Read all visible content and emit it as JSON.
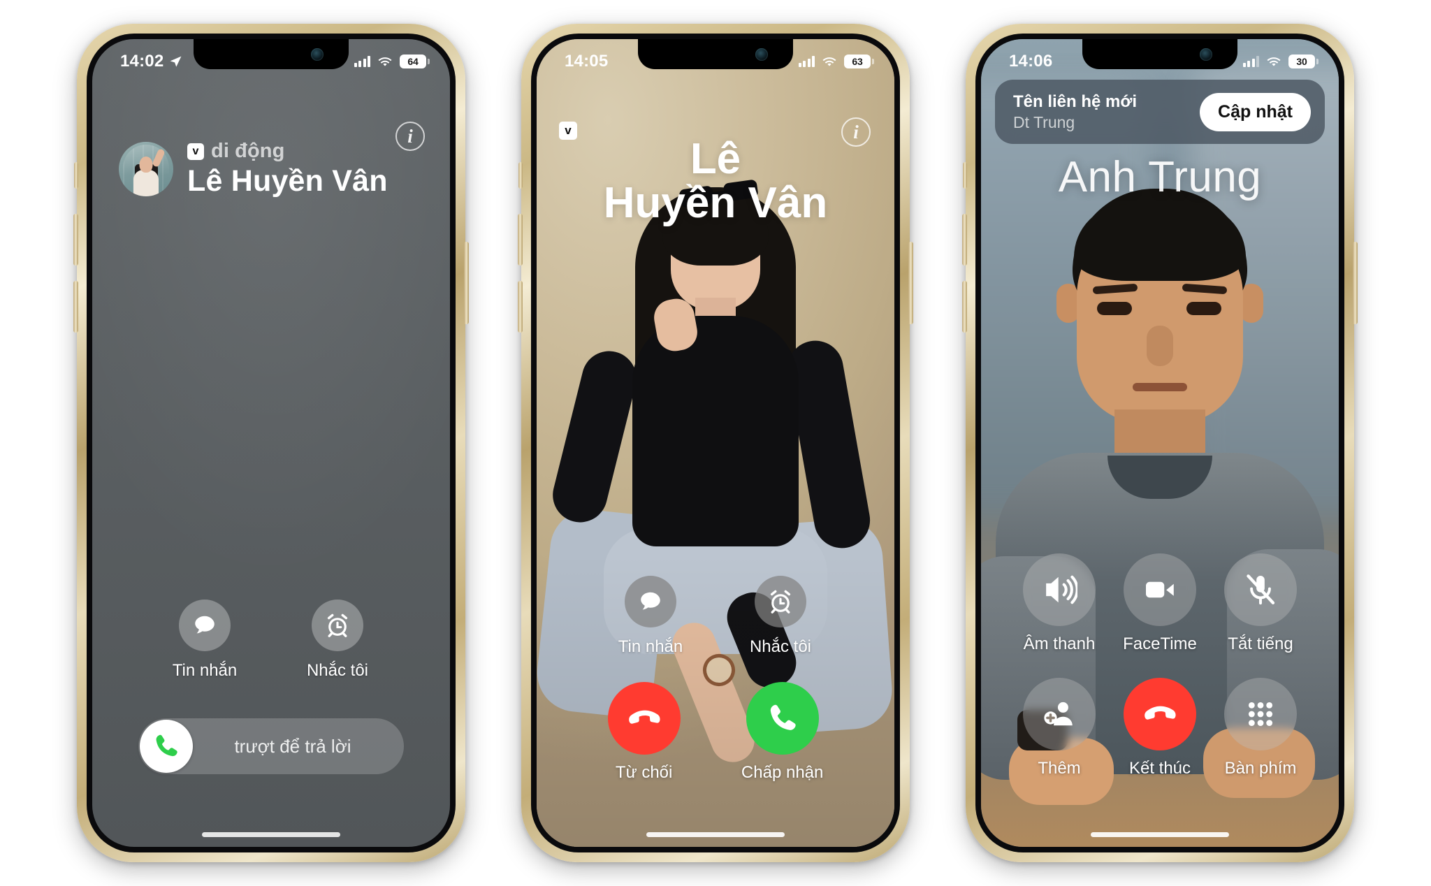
{
  "phones": [
    {
      "id": "phone-locked-incoming",
      "status": {
        "time": "14:02",
        "location_icon": "location-arrow-icon",
        "signal_icon": "cellular-signal-icon",
        "wifi_icon": "wifi-icon",
        "battery_level": "64"
      },
      "call": {
        "info_button": "i",
        "sim_badge": "v",
        "carrier_label": "di động",
        "caller_name": "Lê Huyền Vân",
        "quick_actions": [
          {
            "icon": "message-bubble-icon",
            "label": "Tin nhắn"
          },
          {
            "icon": "alarm-clock-icon",
            "label": "Nhắc tôi"
          }
        ],
        "slide_label": "trượt để trả lời",
        "slide_icon": "phone-handset-icon"
      }
    },
    {
      "id": "phone-photo-incoming",
      "status": {
        "time": "14:05",
        "signal_icon": "cellular-signal-icon",
        "wifi_icon": "wifi-icon",
        "battery_level": "63"
      },
      "call": {
        "info_button": "i",
        "sim_badge": "v",
        "caller_name_line1": "Lê",
        "caller_name_line2": "Huyền Vân",
        "quick_actions": [
          {
            "icon": "message-bubble-icon",
            "label": "Tin nhắn"
          },
          {
            "icon": "alarm-clock-icon",
            "label": "Nhắc tôi"
          }
        ],
        "decline": {
          "icon": "phone-down-icon",
          "label": "Từ chối",
          "color": "#ff3b30"
        },
        "accept": {
          "icon": "phone-handset-icon",
          "label": "Chấp nhận",
          "color": "#2ece4b"
        }
      }
    },
    {
      "id": "phone-active-call",
      "status": {
        "time": "14:06",
        "signal_icon": "cellular-signal-icon",
        "wifi_icon": "wifi-icon",
        "battery_level": "30"
      },
      "banner": {
        "title": "Tên liên hệ mới",
        "subtitle": "Dt Trung",
        "action_label": "Cập nhật"
      },
      "call": {
        "caller_name": "Anh Trung",
        "controls": [
          {
            "icon": "speaker-wave-icon",
            "label": "Âm thanh"
          },
          {
            "icon": "video-camera-icon",
            "label": "FaceTime"
          },
          {
            "icon": "microphone-slash-icon",
            "label": "Tắt tiếng"
          },
          {
            "icon": "add-person-icon",
            "label": "Thêm"
          },
          {
            "icon": "phone-down-icon",
            "label": "Kết thúc"
          },
          {
            "icon": "keypad-icon",
            "label": "Bàn phím"
          }
        ]
      }
    }
  ],
  "colors": {
    "accept_green": "#2ece4b",
    "decline_red": "#ff3b30",
    "locked_bg": "#5b6063",
    "gold_frame": "#d8c391"
  }
}
